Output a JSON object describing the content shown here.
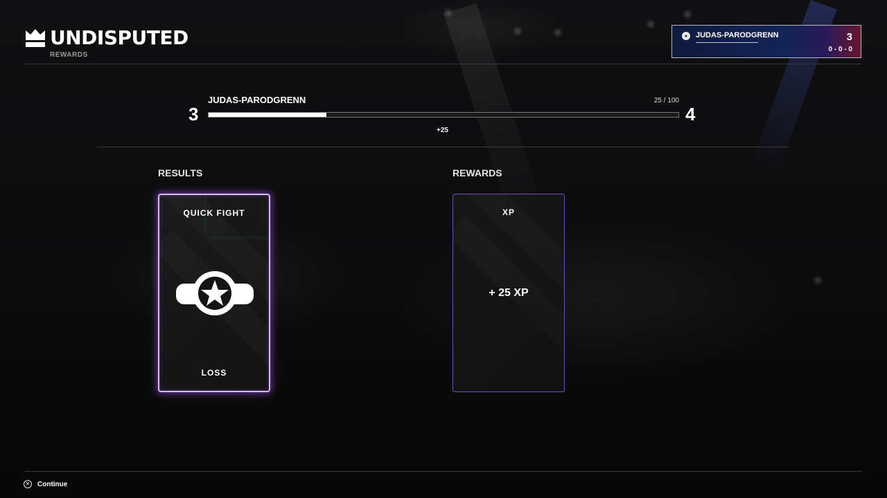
{
  "header": {
    "logo_text": "UNDISPUTED",
    "subtitle": "REWARDS"
  },
  "player_card": {
    "name": "JUDAS-PARODGRENN",
    "level": "3",
    "record": "0 - 0 - 0",
    "icon": "playstation-icon"
  },
  "xp": {
    "player_name": "JUDAS-PARODGRENN",
    "current_level": "3",
    "next_level": "4",
    "progress_text": "25 / 100",
    "progress_fraction": 0.25,
    "gain_text": "+25"
  },
  "results": {
    "section_title": "RESULTS",
    "card_title": "QUICK FIGHT",
    "outcome": "LOSS",
    "icon": "championship-belt-icon"
  },
  "rewards": {
    "section_title": "REWARDS",
    "card_title": "XP",
    "amount": "+ 25 XP"
  },
  "footer": {
    "continue_label": "Continue",
    "button_icon": "cross-button-icon"
  }
}
